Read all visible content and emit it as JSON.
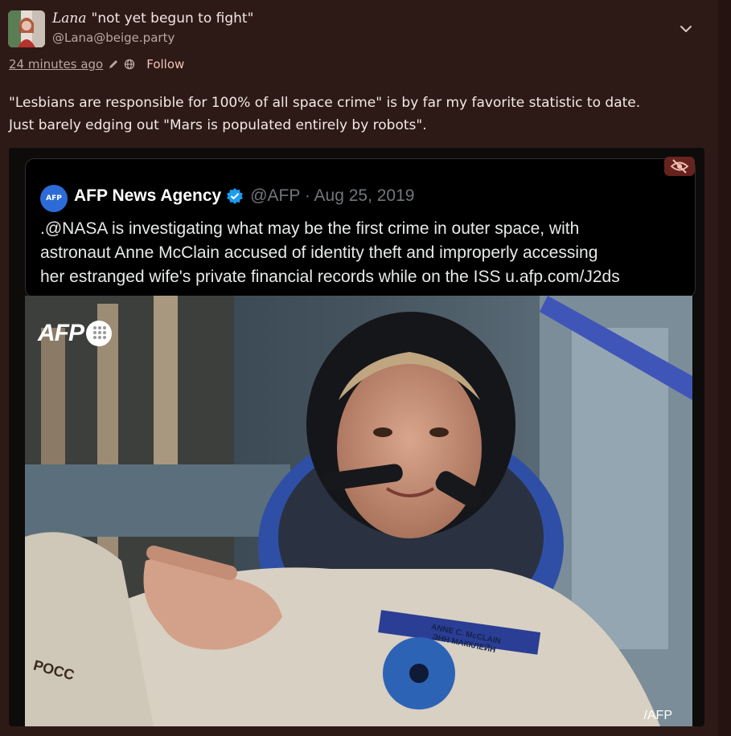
{
  "post": {
    "display_name": "Lana",
    "name_suffix": "\"not yet begun to fight\"",
    "handle": "@Lana@beige.party",
    "timestamp": "24 minutes ago",
    "follow_label": "Follow",
    "body_line1": "\"Lesbians are responsible for 100% of all space crime\" is by far my favorite statistic to date.",
    "body_line2": "Just barely edging out \"Mars is populated entirely by robots\"."
  },
  "embedded_tweet": {
    "avatar_text": "AFP",
    "account_name": "AFP News Agency",
    "account_meta": "@AFP · Aug 25, 2019",
    "text_line1": ".@NASA is investigating what may be the first crime in outer space, with",
    "text_line2": "astronaut Anne McClain accused of identity theft and improperly accessing",
    "text_line3": "her estranged wife's private financial records while on the ISS u.afp.com/J2ds"
  },
  "photo": {
    "logo_text": "AFP",
    "credit_text": "/AFP",
    "patch_line1": "ANNE C. McCLAIN",
    "patch_line2": "ЭНН МАККЛЕЙН",
    "sleeve_text": "РОСС"
  },
  "colors": {
    "background": "#2d1a16",
    "accent": "#f2c3b6",
    "verified": "#1d9bf0"
  },
  "icons": [
    "chevron-down-icon",
    "pencil-icon",
    "globe-icon",
    "eye-slash-icon",
    "verified-badge-icon"
  ]
}
